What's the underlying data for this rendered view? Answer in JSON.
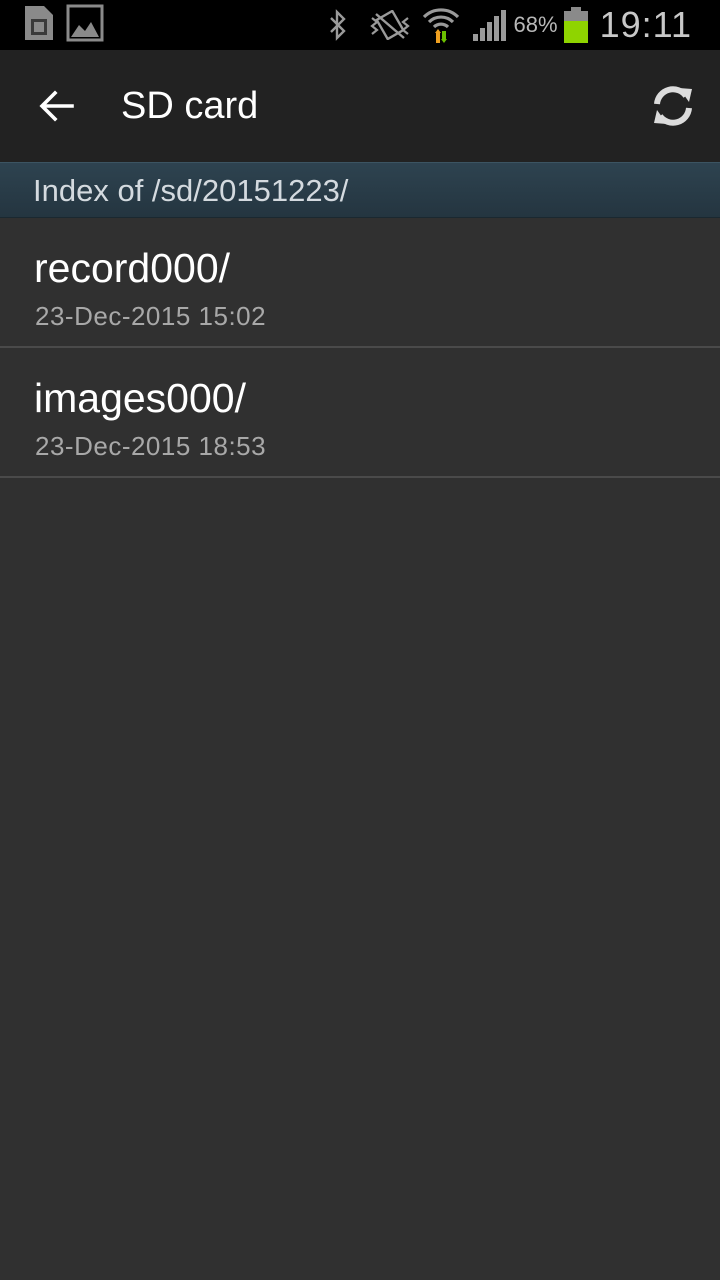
{
  "status_bar": {
    "icons_left": [
      "sim-card-icon",
      "image-icon"
    ],
    "icons_right": [
      "bluetooth-icon",
      "vibrate-icon",
      "wifi-icon",
      "signal-icon",
      "battery-icon"
    ],
    "battery_percent": "68%",
    "battery_color": "#8fd400",
    "time": "19:11"
  },
  "action_bar": {
    "back_icon": "back-arrow-icon",
    "title": "SD card",
    "refresh_icon": "refresh-icon"
  },
  "path_header": {
    "text": "Index of /sd/20151223/"
  },
  "files": [
    {
      "name": "record000/",
      "date": "23-Dec-2015 15:02"
    },
    {
      "name": "images000/",
      "date": "23-Dec-2015 18:53"
    }
  ]
}
